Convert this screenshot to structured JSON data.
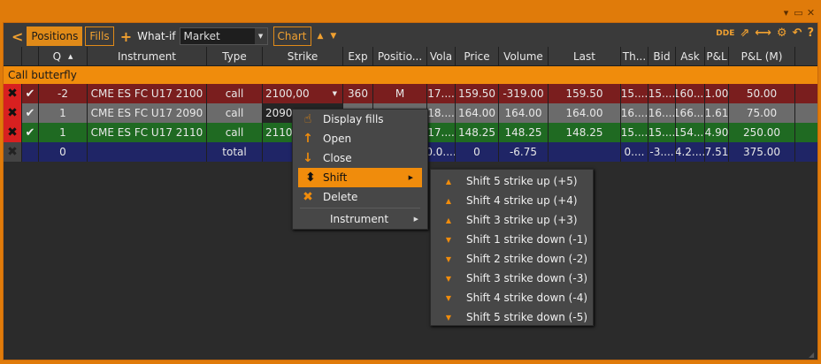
{
  "window": {
    "controls": [
      "▾",
      "▭",
      "✕"
    ]
  },
  "toolbar": {
    "back_icon": "chevron-left-icon",
    "positions_label": "Positions",
    "fills_label": "Fills",
    "whatif_label": "What-if",
    "order_type": "Market",
    "chart_label": "Chart",
    "dde_label": "DDE",
    "accent": "#f08c0c"
  },
  "grid": {
    "headers": [
      "Q",
      "Instrument",
      "Type",
      "Strike",
      "Exp",
      "Positio...",
      "Vola",
      "Price",
      "Volume",
      "Last",
      "Th...",
      "Bid",
      "Ask",
      "P&L",
      "P&L (M)"
    ],
    "group_label": "Call butterfly",
    "rows": [
      {
        "q": "-2",
        "instrument": "CME ES FC U17 2100",
        "type": "call",
        "strike": "2100,00",
        "exp": "360",
        "pos": "M",
        "vola": "17....",
        "price": "159.50",
        "volume": "-319.00",
        "last": "159.50",
        "th": "15....",
        "bid": "15....",
        "ask": "160....",
        "pnl": "1.00",
        "pnlm": "50.00"
      },
      {
        "q": "1",
        "instrument": "CME ES FC U17 2090",
        "type": "call",
        "strike": "2090,",
        "exp": "",
        "pos": "",
        "vola": "18....",
        "price": "164.00",
        "volume": "164.00",
        "last": "164.00",
        "th": "16....",
        "bid": "16....",
        "ask": "166....",
        "pnl": "1.61",
        "pnlm": "75.00"
      },
      {
        "q": "1",
        "instrument": "CME ES FC U17 2110",
        "type": "call",
        "strike": "2110,",
        "exp": "",
        "pos": "",
        "vola": "17....",
        "price": "148.25",
        "volume": "148.25",
        "last": "148.25",
        "th": "15....",
        "bid": "15....",
        "ask": "154....",
        "pnl": "4.90",
        "pnlm": "250.00"
      },
      {
        "q": "0",
        "instrument": "",
        "type": "total",
        "strike": "",
        "exp": "",
        "pos": "",
        "vola": "0.0....",
        "price": "0",
        "volume": "-6.75",
        "last": "",
        "th": "0....",
        "bid": "-3....",
        "ask": "4.2....",
        "pnl": "7.51",
        "pnlm": "375.00"
      }
    ]
  },
  "context_menu": {
    "items": [
      "Display fills",
      "Open",
      "Close",
      "Shift",
      "Delete",
      "Instrument"
    ]
  },
  "shift_submenu": {
    "items": [
      "Shift 5 strike up (+5)",
      "Shift 4 strike up (+4)",
      "Shift 3 strike up (+3)",
      "Shift 1 strike down (-1)",
      "Shift 2 strike down (-2)",
      "Shift 3 strike down (-3)",
      "Shift 4 strike down (-4)",
      "Shift 5 strike down (-5)"
    ]
  }
}
